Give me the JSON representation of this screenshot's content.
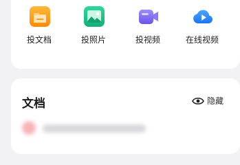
{
  "quick_actions": [
    {
      "label": "投文档",
      "icon": "document-folder-icon",
      "color": "#ff9a12"
    },
    {
      "label": "投照片",
      "icon": "photo-icon",
      "color": "#1fbe8a"
    },
    {
      "label": "投视频",
      "icon": "video-camera-icon",
      "color": "#7a68f2"
    },
    {
      "label": "在线视频",
      "icon": "cloud-play-icon",
      "color": "#2e8bff"
    }
  ],
  "documents": {
    "title": "文档",
    "hide_label": "隐藏",
    "hide_icon": "eye-icon"
  }
}
